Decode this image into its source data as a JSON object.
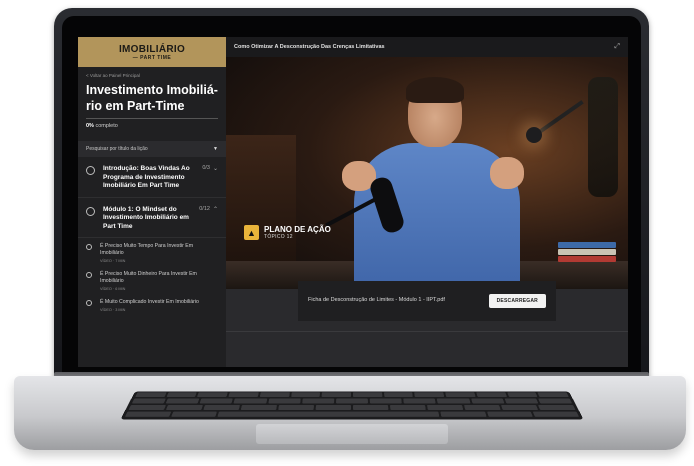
{
  "logo": {
    "main": "IMOBILIÁRIO",
    "sub": "— PART TIME"
  },
  "sidebar": {
    "back_link": "< Voltar ao Painel Principal",
    "course_title": "Investimento Imobiliá-rio em Part-Time",
    "progress_value": "0%",
    "progress_label": "completo",
    "search_placeholder": "Pesquisar por título da lição",
    "modules": [
      {
        "title": "Introdução: Boas Vindas Ao Programa de Investimento Imobiliário Em Part Time",
        "count": "0/3",
        "chevron": "⌄"
      },
      {
        "title": "Módulo 1: O Mindset do Investimento Imobiliário em Part Time",
        "count": "0/12",
        "chevron": "⌃"
      }
    ],
    "lessons": [
      {
        "title": "É Preciso Muito Tempo Para Investir Em Imobiliário",
        "meta": "VÍDEO · 7 MIN"
      },
      {
        "title": "É Preciso Muito Dinheiro Para Investir Em Imobiliário",
        "meta": "VÍDEO · 6 MIN"
      },
      {
        "title": "É Muito Complicado Investir Em Imobiliário",
        "meta": "VÍDEO · 3 MIN"
      }
    ]
  },
  "main": {
    "lesson_title": "Como Otimizar A Desconstrução Das Crenças Limitativas",
    "video_caption": {
      "title": "PLANO DE AÇÃO",
      "subtitle": "TÓPICO 12"
    },
    "attachment": {
      "file_name": "Ficha de Desconstrução de Limites - Módulo 1 - IIPT.pdf",
      "download_label": "DESCARREGAR"
    }
  },
  "colors": {
    "brand_gold": "#b2955b",
    "caption_yellow": "#e9b43a",
    "sidebar_bg": "#202022"
  }
}
